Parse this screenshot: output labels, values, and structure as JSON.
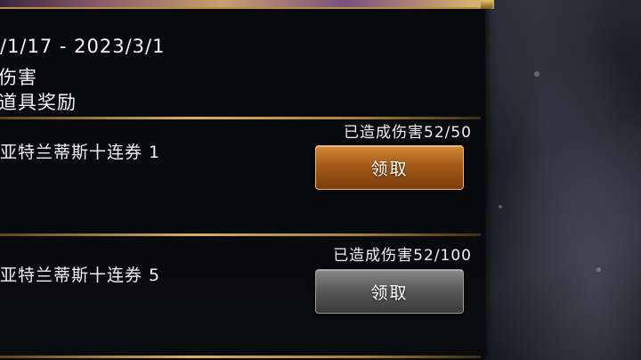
{
  "event": {
    "date_range": "/1/17 - 2023/3/1",
    "condition": "伤害",
    "reward_type": "道具奖励"
  },
  "rewards": [
    {
      "name": "亚特兰蒂斯十连券 1",
      "progress": "已造成伤害52/50",
      "claim_label": "领取",
      "state": "claimable"
    },
    {
      "name": "亚特兰蒂斯十连券 5",
      "progress": "已造成伤害52/100",
      "claim_label": "领取",
      "state": "locked"
    }
  ],
  "colors": {
    "accent_gold": "#d9b060",
    "claim_active": "#a45a18",
    "claim_disabled": "#5a5a5a"
  }
}
